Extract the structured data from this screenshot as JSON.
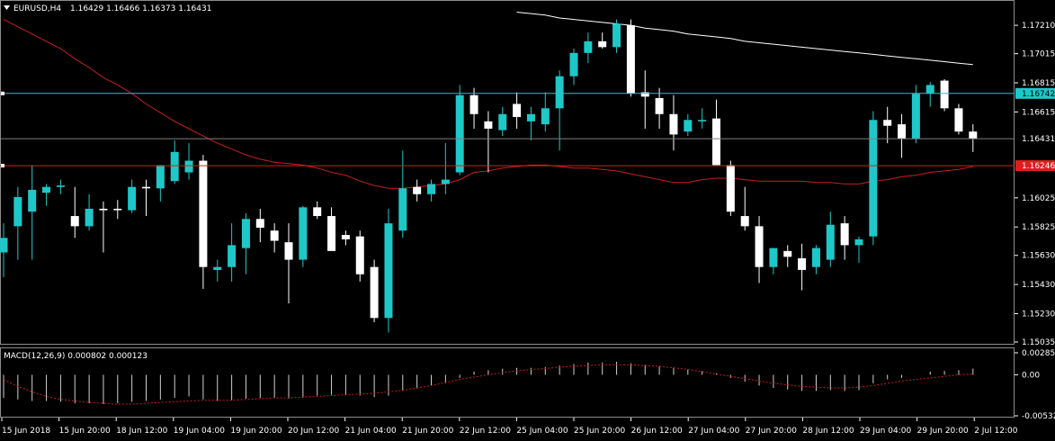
{
  "header": {
    "arrow_icon": "triangle-down-icon",
    "symbol": "EURUSD,H4",
    "ohlc": "1.16429 1.16466 1.16373 1.16431"
  },
  "macd": {
    "label": "MACD(12,26,9) 0.000802 0.000123",
    "ticks": [
      "0.002857",
      "0.00",
      "-0.005325"
    ]
  },
  "price_ticks": [
    "1.17210",
    "1.17015",
    "1.16815",
    "1.16615",
    "1.16431",
    "1.16025",
    "1.15825",
    "1.15630",
    "1.15430",
    "1.15230",
    "1.15035"
  ],
  "tags": {
    "cyan_line": "1.16742",
    "current": "1.16431",
    "red_line": "1.16246"
  },
  "time_labels": [
    "15 Jun 2018",
    "15 Jun 20:00",
    "18 Jun 12:00",
    "19 Jun 04:00",
    "19 Jun 20:00",
    "20 Jun 12:00",
    "21 Jun 04:00",
    "21 Jun 20:00",
    "22 Jun 12:00",
    "25 Jun 04:00",
    "25 Jun 20:00",
    "26 Jun 12:00",
    "27 Jun 04:00",
    "27 Jun 20:00",
    "28 Jun 12:00",
    "29 Jun 04:00",
    "29 Jun 20:00",
    "2 Jul 12:00"
  ],
  "colors": {
    "bull": "#1ec8c8",
    "bear": "#ffffff",
    "ma_red": "#c81e1e",
    "ma_white": "#ffffff",
    "cyan_line": "#1ec8c8",
    "red_line": "#dc1e1e",
    "grid": "#5a5a5a"
  },
  "chart_data": {
    "type": "candlestick",
    "symbol": "EURUSD",
    "timeframe": "H4",
    "ylim": [
      1.15035,
      1.1726
    ],
    "candles": [
      {
        "o": 1.1565,
        "h": 1.1585,
        "l": 1.1548,
        "c": 1.1575
      },
      {
        "o": 1.1583,
        "h": 1.161,
        "l": 1.156,
        "c": 1.1603
      },
      {
        "o": 1.1593,
        "h": 1.1625,
        "l": 1.156,
        "c": 1.1608
      },
      {
        "o": 1.1606,
        "h": 1.1612,
        "l": 1.1597,
        "c": 1.161
      },
      {
        "o": 1.161,
        "h": 1.1615,
        "l": 1.1605,
        "c": 1.1611
      },
      {
        "o": 1.159,
        "h": 1.161,
        "l": 1.1575,
        "c": 1.1583
      },
      {
        "o": 1.1583,
        "h": 1.1605,
        "l": 1.158,
        "c": 1.1595
      },
      {
        "o": 1.1595,
        "h": 1.16,
        "l": 1.1565,
        "c": 1.1594
      },
      {
        "o": 1.1595,
        "h": 1.1601,
        "l": 1.1588,
        "c": 1.1594
      },
      {
        "o": 1.1594,
        "h": 1.1615,
        "l": 1.1592,
        "c": 1.161
      },
      {
        "o": 1.161,
        "h": 1.1615,
        "l": 1.159,
        "c": 1.1609
      },
      {
        "o": 1.1609,
        "h": 1.1625,
        "l": 1.16,
        "c": 1.1625
      },
      {
        "o": 1.1614,
        "h": 1.1642,
        "l": 1.1612,
        "c": 1.1634
      },
      {
        "o": 1.162,
        "h": 1.164,
        "l": 1.1615,
        "c": 1.1628
      },
      {
        "o": 1.1628,
        "h": 1.1632,
        "l": 1.154,
        "c": 1.1555
      },
      {
        "o": 1.1553,
        "h": 1.156,
        "l": 1.1545,
        "c": 1.1555
      },
      {
        "o": 1.1555,
        "h": 1.1585,
        "l": 1.1545,
        "c": 1.157
      },
      {
        "o": 1.1568,
        "h": 1.1592,
        "l": 1.155,
        "c": 1.1588
      },
      {
        "o": 1.1588,
        "h": 1.1595,
        "l": 1.1572,
        "c": 1.1582
      },
      {
        "o": 1.158,
        "h": 1.1585,
        "l": 1.1565,
        "c": 1.1573
      },
      {
        "o": 1.1572,
        "h": 1.1585,
        "l": 1.153,
        "c": 1.156
      },
      {
        "o": 1.156,
        "h": 1.1597,
        "l": 1.1555,
        "c": 1.1596
      },
      {
        "o": 1.1596,
        "h": 1.16,
        "l": 1.1588,
        "c": 1.159
      },
      {
        "o": 1.159,
        "h": 1.1596,
        "l": 1.1568,
        "c": 1.1566
      },
      {
        "o": 1.1577,
        "h": 1.158,
        "l": 1.157,
        "c": 1.1574
      },
      {
        "o": 1.1576,
        "h": 1.158,
        "l": 1.1545,
        "c": 1.155
      },
      {
        "o": 1.1555,
        "h": 1.156,
        "l": 1.1517,
        "c": 1.152
      },
      {
        "o": 1.152,
        "h": 1.1595,
        "l": 1.151,
        "c": 1.1585
      },
      {
        "o": 1.158,
        "h": 1.1635,
        "l": 1.1575,
        "c": 1.1609
      },
      {
        "o": 1.161,
        "h": 1.1615,
        "l": 1.16,
        "c": 1.1605
      },
      {
        "o": 1.1605,
        "h": 1.1615,
        "l": 1.16,
        "c": 1.1612
      },
      {
        "o": 1.1612,
        "h": 1.164,
        "l": 1.1605,
        "c": 1.1615
      },
      {
        "o": 1.162,
        "h": 1.168,
        "l": 1.1618,
        "c": 1.1673
      },
      {
        "o": 1.1673,
        "h": 1.1678,
        "l": 1.165,
        "c": 1.166
      },
      {
        "o": 1.1655,
        "h": 1.1662,
        "l": 1.162,
        "c": 1.165
      },
      {
        "o": 1.1649,
        "h": 1.1665,
        "l": 1.1645,
        "c": 1.166
      },
      {
        "o": 1.1667,
        "h": 1.1675,
        "l": 1.165,
        "c": 1.1658
      },
      {
        "o": 1.1655,
        "h": 1.1665,
        "l": 1.1642,
        "c": 1.166
      },
      {
        "o": 1.1653,
        "h": 1.1675,
        "l": 1.1648,
        "c": 1.1664
      },
      {
        "o": 1.1664,
        "h": 1.169,
        "l": 1.1635,
        "c": 1.1686
      },
      {
        "o": 1.1686,
        "h": 1.1705,
        "l": 1.168,
        "c": 1.1702
      },
      {
        "o": 1.1702,
        "h": 1.1716,
        "l": 1.1695,
        "c": 1.171
      },
      {
        "o": 1.171,
        "h": 1.1716,
        "l": 1.1705,
        "c": 1.1706
      },
      {
        "o": 1.1706,
        "h": 1.1725,
        "l": 1.1702,
        "c": 1.1722
      },
      {
        "o": 1.1721,
        "h": 1.1725,
        "l": 1.1672,
        "c": 1.1674
      },
      {
        "o": 1.1675,
        "h": 1.169,
        "l": 1.165,
        "c": 1.1672
      },
      {
        "o": 1.1671,
        "h": 1.1678,
        "l": 1.165,
        "c": 1.166
      },
      {
        "o": 1.166,
        "h": 1.1673,
        "l": 1.1635,
        "c": 1.1646
      },
      {
        "o": 1.1648,
        "h": 1.166,
        "l": 1.1645,
        "c": 1.1656
      },
      {
        "o": 1.1655,
        "h": 1.1664,
        "l": 1.165,
        "c": 1.1656
      },
      {
        "o": 1.1657,
        "h": 1.167,
        "l": 1.1625,
        "c": 1.1625
      },
      {
        "o": 1.1625,
        "h": 1.1628,
        "l": 1.159,
        "c": 1.1593
      },
      {
        "o": 1.159,
        "h": 1.161,
        "l": 1.158,
        "c": 1.1583
      },
      {
        "o": 1.1583,
        "h": 1.159,
        "l": 1.1544,
        "c": 1.1555
      },
      {
        "o": 1.1555,
        "h": 1.1568,
        "l": 1.155,
        "c": 1.1568
      },
      {
        "o": 1.1566,
        "h": 1.157,
        "l": 1.1555,
        "c": 1.1562
      },
      {
        "o": 1.1561,
        "h": 1.1571,
        "l": 1.1539,
        "c": 1.1553
      },
      {
        "o": 1.1555,
        "h": 1.157,
        "l": 1.155,
        "c": 1.1568
      },
      {
        "o": 1.156,
        "h": 1.1593,
        "l": 1.1555,
        "c": 1.1584
      },
      {
        "o": 1.1585,
        "h": 1.159,
        "l": 1.156,
        "c": 1.157
      },
      {
        "o": 1.157,
        "h": 1.1576,
        "l": 1.1558,
        "c": 1.1574
      },
      {
        "o": 1.1576,
        "h": 1.1662,
        "l": 1.157,
        "c": 1.1656
      },
      {
        "o": 1.1656,
        "h": 1.1665,
        "l": 1.164,
        "c": 1.1652
      },
      {
        "o": 1.1653,
        "h": 1.166,
        "l": 1.163,
        "c": 1.1643
      },
      {
        "o": 1.1643,
        "h": 1.168,
        "l": 1.164,
        "c": 1.1674
      },
      {
        "o": 1.1674,
        "h": 1.1682,
        "l": 1.1665,
        "c": 1.168
      },
      {
        "o": 1.1683,
        "h": 1.1684,
        "l": 1.1662,
        "c": 1.1664
      },
      {
        "o": 1.1664,
        "h": 1.1667,
        "l": 1.1646,
        "c": 1.1648
      },
      {
        "o": 1.1648,
        "h": 1.1653,
        "l": 1.1634,
        "c": 1.1643
      }
    ],
    "ma_red": [
      1.1725,
      1.172,
      1.1715,
      1.171,
      1.1705,
      1.1698,
      1.1692,
      1.1685,
      1.168,
      1.1674,
      1.1667,
      1.1661,
      1.1655,
      1.165,
      1.1645,
      1.164,
      1.1636,
      1.1632,
      1.1629,
      1.1627,
      1.1626,
      1.1625,
      1.1623,
      1.162,
      1.1618,
      1.1614,
      1.1611,
      1.1609,
      1.1609,
      1.161,
      1.1611,
      1.1612,
      1.1615,
      1.162,
      1.1621,
      1.1623,
      1.1624,
      1.1625,
      1.1625,
      1.1624,
      1.1623,
      1.1623,
      1.1622,
      1.1621,
      1.1619,
      1.1617,
      1.1615,
      1.1613,
      1.1613,
      1.1615,
      1.1616,
      1.1616,
      1.1615,
      1.1614,
      1.1614,
      1.1614,
      1.1614,
      1.1613,
      1.1613,
      1.1612,
      1.1612,
      1.1614,
      1.1615,
      1.1617,
      1.1618,
      1.162,
      1.1621,
      1.1622,
      1.1624
    ],
    "ma_white": [
      null,
      null,
      null,
      null,
      null,
      null,
      null,
      null,
      null,
      null,
      null,
      null,
      null,
      null,
      null,
      null,
      null,
      null,
      null,
      null,
      null,
      null,
      null,
      null,
      null,
      null,
      null,
      null,
      null,
      null,
      null,
      null,
      null,
      null,
      null,
      null,
      1.173,
      1.1729,
      1.1728,
      1.1726,
      1.1725,
      1.1724,
      1.1723,
      1.1722,
      1.1721,
      1.1719,
      1.1718,
      1.1717,
      1.1715,
      1.1714,
      1.1713,
      1.1712,
      1.171,
      1.1709,
      1.1708,
      1.1707,
      1.1706,
      1.1705,
      1.1704,
      1.1703,
      1.1702,
      1.1701,
      1.17,
      1.1699,
      1.1698,
      1.1697,
      1.1696,
      1.1695,
      1.1694
    ],
    "h_lines": [
      {
        "value": 1.16742,
        "color": "#1ec8c8"
      },
      {
        "value": 1.16431,
        "color": "#808080"
      },
      {
        "value": 1.16246,
        "color": "#dc1e1e"
      }
    ],
    "macd": {
      "ylim": [
        -0.005325,
        0.002857
      ],
      "histogram": [
        -0.003,
        -0.0032,
        -0.0034,
        -0.0034,
        -0.0035,
        -0.0037,
        -0.0037,
        -0.0038,
        -0.0037,
        -0.0035,
        -0.0034,
        -0.0032,
        -0.003,
        -0.0028,
        -0.0032,
        -0.0034,
        -0.0033,
        -0.0031,
        -0.003,
        -0.003,
        -0.0031,
        -0.003,
        -0.0027,
        -0.0026,
        -0.0026,
        -0.0027,
        -0.0029,
        -0.0027,
        -0.0021,
        -0.0018,
        -0.0014,
        -0.0011,
        -0.0004,
        0.0004,
        0.0006,
        0.0008,
        0.0009,
        0.0009,
        0.001,
        0.0012,
        0.0014,
        0.0016,
        0.0016,
        0.0017,
        0.0015,
        0.0013,
        0.0011,
        0.0009,
        0.0007,
        0.0005,
        0.0002,
        -0.0004,
        -0.0009,
        -0.0014,
        -0.0017,
        -0.0019,
        -0.0021,
        -0.0021,
        -0.002,
        -0.0021,
        -0.002,
        -0.0011,
        -0.0006,
        -0.0004,
        0.0,
        0.0004,
        0.0005,
        0.0006,
        0.0008
      ],
      "signal": [
        -0.0006,
        -0.0015,
        -0.0022,
        -0.0028,
        -0.0032,
        -0.0034,
        -0.0036,
        -0.0037,
        -0.0038,
        -0.0038,
        -0.0037,
        -0.0036,
        -0.0035,
        -0.0034,
        -0.0033,
        -0.0033,
        -0.0033,
        -0.0032,
        -0.0031,
        -0.003,
        -0.003,
        -0.0029,
        -0.0028,
        -0.0027,
        -0.0026,
        -0.0025,
        -0.0024,
        -0.0022,
        -0.002,
        -0.0017,
        -0.0014,
        -0.001,
        -0.0006,
        -0.0003,
        0.0,
        0.0003,
        0.0005,
        0.0007,
        0.0008,
        0.001,
        0.0011,
        0.0012,
        0.0013,
        0.0013,
        0.0013,
        0.0012,
        0.0011,
        0.0009,
        0.0007,
        0.0004,
        0.0001,
        -0.0002,
        -0.0005,
        -0.0008,
        -0.0011,
        -0.0013,
        -0.0015,
        -0.0016,
        -0.0017,
        -0.0017,
        -0.0016,
        -0.0014,
        -0.0011,
        -0.0008,
        -0.0006,
        -0.0004,
        -0.0002,
        0.0,
        0.0001
      ]
    }
  }
}
